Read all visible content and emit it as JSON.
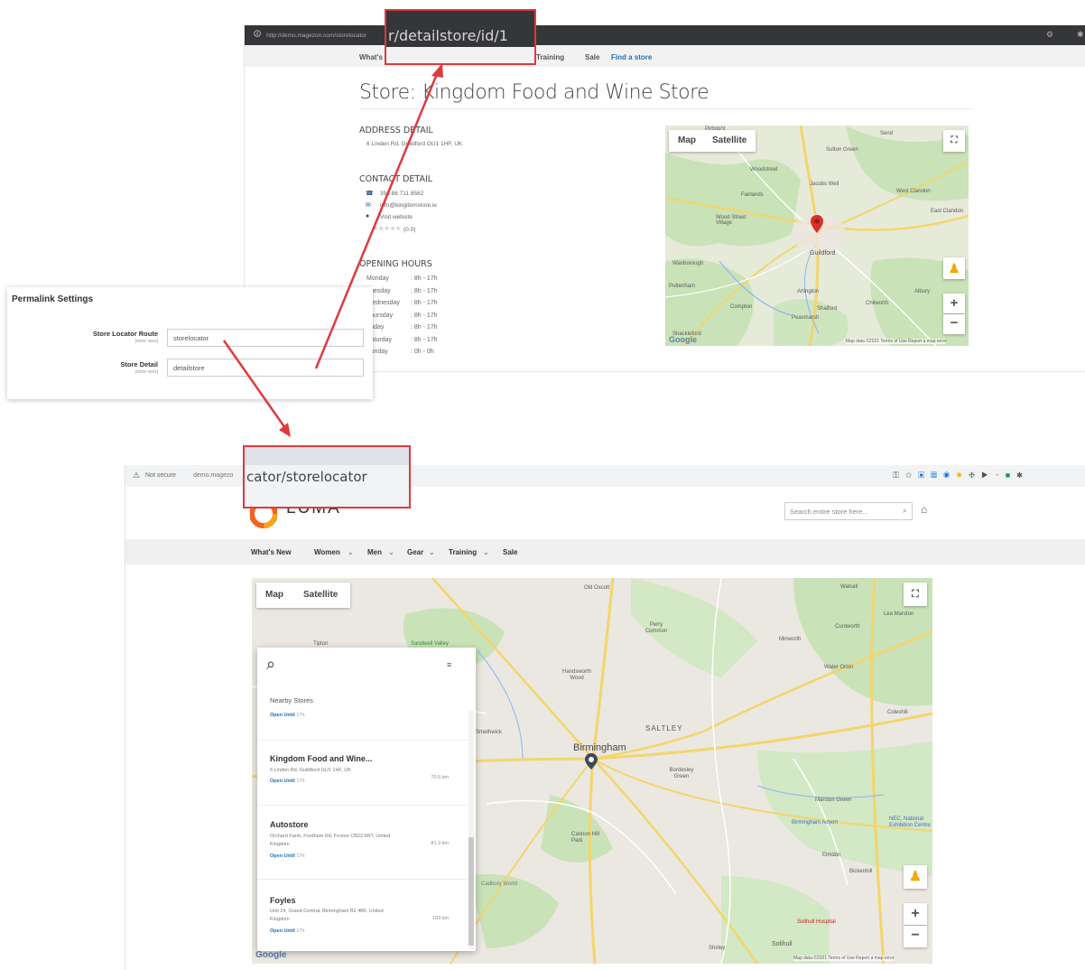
{
  "detail_page": {
    "url_prefix": "http://demo.magezon.com/storelocator",
    "url_highlight": "r/detailstore/id/1",
    "nav": [
      "What's",
      "Training",
      "Sale",
      "Find a store"
    ],
    "title": "Store: Kingdom Food and Wine Store",
    "address_heading": "ADDRESS DETAIL",
    "address": "6 Linden Rd, Guildford GU1 1HF, UK",
    "contact_heading": "CONTACT DETAIL",
    "phone": "353 86 711 8562",
    "email": "info@kingdomstore.ie",
    "website": "Visit website",
    "rating": "(0.0)",
    "hours_heading": "OPENING HOURS",
    "hours": [
      {
        "day": "Monday",
        "time": ": 8h - 17h"
      },
      {
        "day": "Tuesday",
        "time": ": 8h - 17h"
      },
      {
        "day": "Wednesday",
        "time": ": 8h - 17h"
      },
      {
        "day": "Thursday",
        "time": ": 8h - 17h"
      },
      {
        "day": "Friday",
        "time": ": 8h - 17h"
      },
      {
        "day": "Saturday",
        "time": ": 8h - 17h"
      },
      {
        "day": "Sunday",
        "time": ": 0h - 0h"
      }
    ],
    "map": {
      "map_label": "Map",
      "satellite_label": "Satellite",
      "places": [
        "Pirbright",
        "Send",
        "Sutton Green",
        "Woodstreet",
        "Jacobs Well",
        "West Clandon",
        "Fairlands",
        "East Clandon",
        "Wood Street Village",
        "Guildford",
        "Wanborough",
        "Puttenham",
        "Artington",
        "Albury",
        "Compton",
        "Shalford",
        "Chilworth",
        "Peasmarsh",
        "Shackleford"
      ],
      "footer": "Map data ©2021  Terms of Use  Report a map error"
    }
  },
  "admin": {
    "title": "Permalink Settings",
    "fields": [
      {
        "label": "Store Locator Route",
        "scope": "[store view]",
        "value": "storelocator"
      },
      {
        "label": "Store Detail",
        "scope": "[store view]",
        "value": "detailstore"
      }
    ]
  },
  "locator_page": {
    "not_secure": "Not secure",
    "url_prefix": "demo.magezo",
    "url_highlight": "cator/storelocator",
    "logo": "LUMA",
    "search_placeholder": "Search entire store here...",
    "nav": [
      "What's New",
      "Women",
      "Men",
      "Gear",
      "Training",
      "Sale"
    ],
    "map": {
      "map_label": "Map",
      "satellite_label": "Satellite",
      "places": [
        "Old Oscott",
        "Walsall",
        "Lea Marston",
        "Perry Common",
        "Curdworth",
        "Minworth",
        "Tipton",
        "Sandwell Valley",
        "Water Orton",
        "Handsworth Wood",
        "SALTLEY",
        "Coleshill",
        "Birmingham",
        "Bordesley Green",
        "Marston Green",
        "Birmingham Airport",
        "NEC, National Exhibition Centre",
        "Elmdon",
        "Cannon Hill Park",
        "Cadbury World",
        "Bickenhill",
        "Solihull Hospital",
        "Solihull",
        "Shirley",
        "Smethwick"
      ],
      "footer": "Map data ©2021  Terms of Use  Report a map error"
    },
    "panel": {
      "heading": "Nearby Stores",
      "first_open": "Open Until",
      "first_open_time": "17h",
      "stores": [
        {
          "name": "Kingdom Food and Wine...",
          "address": "6 Linden Rd, Guildford GU1 1HF, UK",
          "open": "Open Until",
          "time": "17h",
          "distance": "70.5 km"
        },
        {
          "name": "Autostore",
          "address": "Orchard Farm, Fordham Rd, Foxton CB22 6RT, United Kingdom",
          "open": "Open Until",
          "time": "17h",
          "distance": "81.3 km"
        },
        {
          "name": "Foyles",
          "address": "Unit 24, Grand Central, Birmingham B2 4BF, United Kingdom",
          "open": "Open Until",
          "time": "17h",
          "distance": "103 km"
        }
      ]
    }
  },
  "colors": {
    "highlight": "#e0393e",
    "map_pin": "#d93025",
    "link": "#1f6fb2"
  }
}
